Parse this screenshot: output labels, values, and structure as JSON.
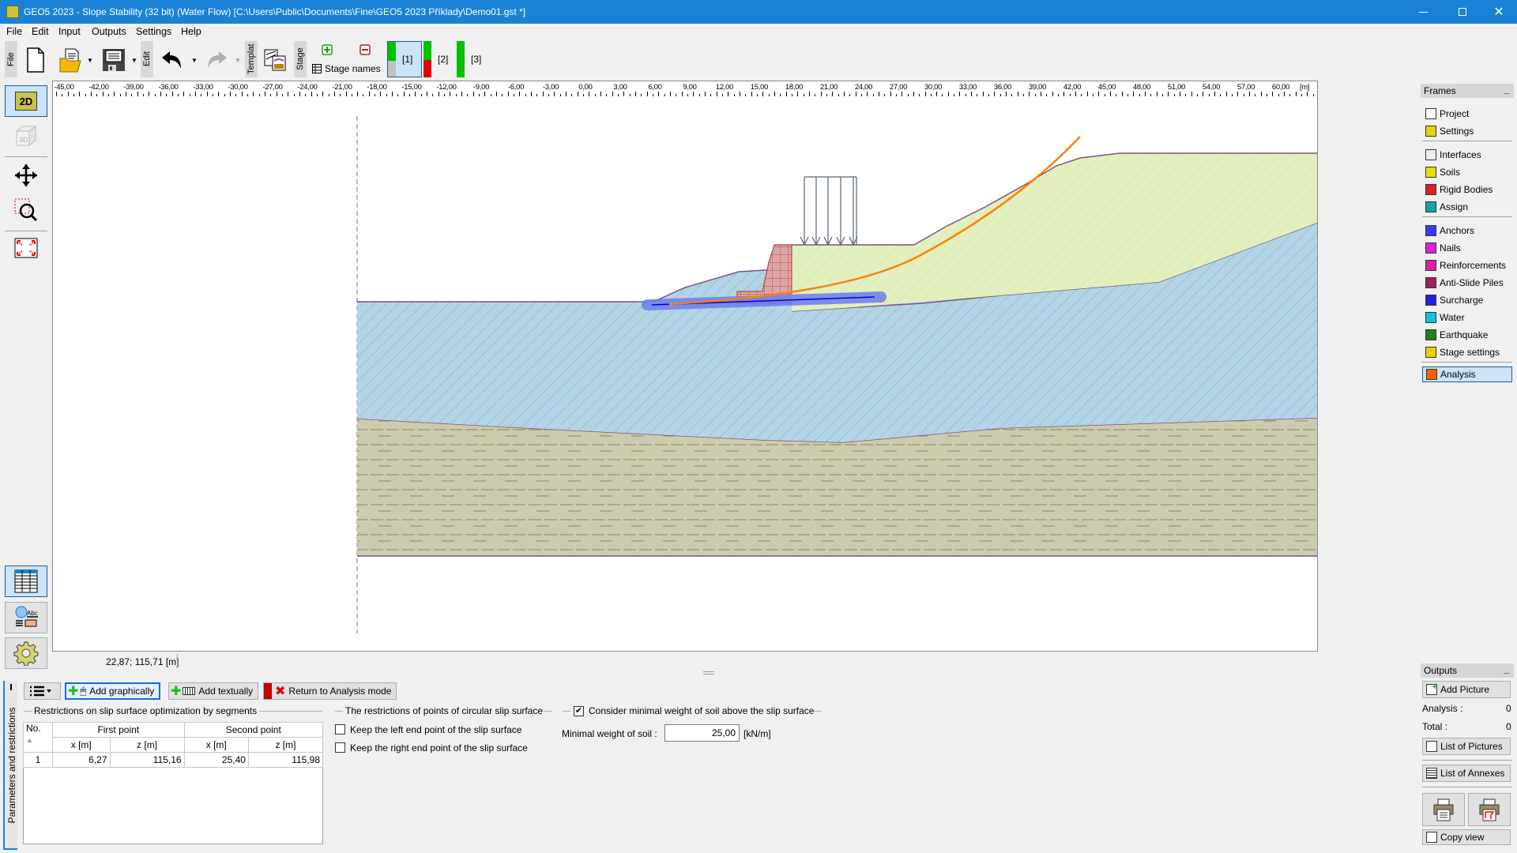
{
  "window": {
    "title": "GEO5 2023 - Slope Stability (32 bit) (Water Flow) [C:\\Users\\Public\\Documents\\Fine\\GEO5 2023 Příklady\\Demo01.gst *]",
    "controls": {
      "minimize": "—",
      "maximize": "☐",
      "close": "✕"
    }
  },
  "menu": [
    "File",
    "Edit",
    "Input",
    "Outputs",
    "Settings",
    "Help"
  ],
  "toolbar": {
    "file_tab": "File",
    "edit_tab": "Edit",
    "template_tab": "Templat",
    "stage_tab": "Stage",
    "stage_names": "Stage names",
    "stages": [
      {
        "label": "[1]",
        "selected": true,
        "status_top": "#00c000",
        "status_bottom": "#c0c0c0"
      },
      {
        "label": "[2]",
        "selected": false,
        "status_top": "#00c000",
        "status_bottom": "#e00000"
      },
      {
        "label": "[3]",
        "selected": false,
        "status_top": "#00c000",
        "status_bottom": "#00c000"
      }
    ]
  },
  "ruler": {
    "unit": "[m]",
    "ticks": [
      "-45,00",
      "-42,00",
      "-39,00",
      "-36,00",
      "-33,00",
      "-30,00",
      "-27,00",
      "-24,00",
      "-21,00",
      "-18,00",
      "-15,00",
      "-12,00",
      "-9,00",
      "-6,00",
      "-3,00",
      "0,00",
      "3,00",
      "6,00",
      "9,00",
      "12,00",
      "15,00",
      "18,00",
      "21,00",
      "24,00",
      "27,00",
      "30,00",
      "33,00",
      "36,00",
      "39,00",
      "42,00",
      "45,00",
      "48,00",
      "51,00",
      "54,00",
      "57,00",
      "60,00"
    ]
  },
  "left_tools": {
    "view2d": "2D",
    "view3d": "3D"
  },
  "status": {
    "coordinates": "22,87; 115,71 [m]"
  },
  "frames": {
    "header": "Frames",
    "items": [
      {
        "label": "Project",
        "icon": "document-icon"
      },
      {
        "label": "Settings",
        "icon": "gear-icon"
      },
      {
        "label": "Interfaces",
        "icon": "interfaces-icon"
      },
      {
        "label": "Soils",
        "icon": "soil-icon"
      },
      {
        "label": "Rigid Bodies",
        "icon": "rigid-body-icon"
      },
      {
        "label": "Assign",
        "icon": "assign-icon"
      },
      {
        "label": "Anchors",
        "icon": "anchor-icon"
      },
      {
        "label": "Nails",
        "icon": "nail-icon"
      },
      {
        "label": "Reinforcements",
        "icon": "reinforcement-icon"
      },
      {
        "label": "Anti-Slide Piles",
        "icon": "pile-icon"
      },
      {
        "label": "Surcharge",
        "icon": "surcharge-icon"
      },
      {
        "label": "Water",
        "icon": "water-icon"
      },
      {
        "label": "Earthquake",
        "icon": "earthquake-icon"
      },
      {
        "label": "Stage settings",
        "icon": "stage-settings-icon"
      },
      {
        "label": "Analysis",
        "icon": "analysis-icon",
        "selected": true
      }
    ]
  },
  "outputs": {
    "header": "Outputs",
    "add_picture": "Add Picture",
    "analysis_label": "Analysis :",
    "analysis_count": "0",
    "total_label": "Total :",
    "total_count": "0",
    "list_of_pictures": "List of Pictures",
    "list_of_annexes": "List of Annexes",
    "copy_view": "Copy view"
  },
  "bottom": {
    "panel_label": "Parameters and restrictions",
    "add_graphically": "Add graphically",
    "add_textually": "Add textually",
    "return_button": "Return to Analysis mode",
    "segments_group": "Restrictions on slip surface optimization by segments",
    "table": {
      "headers": {
        "no": "No.",
        "first_point": "First point",
        "second_point": "Second point",
        "x": "x [m]",
        "z": "z [m]"
      },
      "rows": [
        {
          "no": "1",
          "x1": "6,27",
          "z1": "115,16",
          "x2": "25,40",
          "z2": "115,98"
        }
      ]
    },
    "circular_group": "The restrictions of points of circular slip surface",
    "keep_left": "Keep the left end point of the slip surface",
    "keep_left_checked": false,
    "keep_right": "Keep the right end point of the slip surface",
    "keep_right_checked": false,
    "min_weight_group": "Consider minimal weight of soil above the slip surface",
    "min_weight_checked": true,
    "min_weight_label": "Minimal weight of soil :",
    "min_weight_value": "25,00",
    "min_weight_unit": "[kN/m]"
  },
  "colors": {
    "titlebar": "#1a82d6",
    "soil_top": "#e2f0bf",
    "soil_middle": "#b3d4e5",
    "soil_bottom": "#cccbb0",
    "slip_surface": "#ff7f00",
    "segment_highlight": "#6b7ff0",
    "rigid_body": "#dca6a6"
  }
}
